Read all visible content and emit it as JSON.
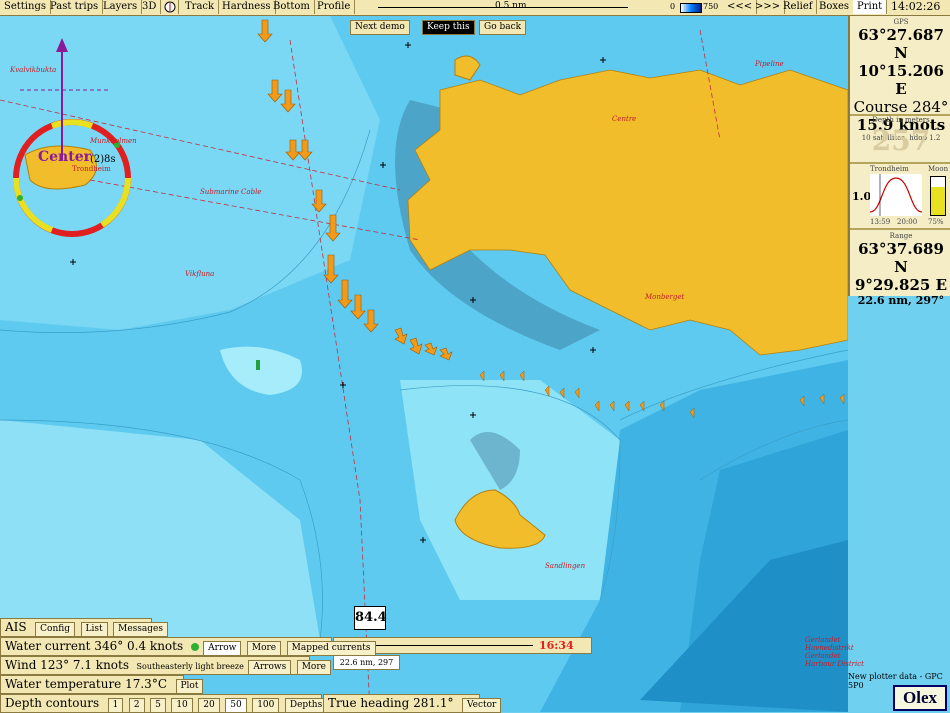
{
  "menu": {
    "items": [
      "Settings",
      "Past trips",
      "Layers",
      "3D",
      "Track",
      "Hardness",
      "Bottom",
      "Profile"
    ],
    "right_items": [
      "<<<",
      ">>>",
      "Relief",
      "Boxes",
      "Print"
    ],
    "scale_label": "0.5 nm",
    "depth_min": "0",
    "depth_max": "750",
    "clock": "14:02:26"
  },
  "demo": {
    "next": "Next demo",
    "keep": "Keep this",
    "back": "Go back"
  },
  "gps": {
    "source": "GPS",
    "lat": "63°27.687 N",
    "lon": "10°15.206 E",
    "course": "Course 284°",
    "speed": "15.9 knots",
    "sats": "10 satellites, hdop 1.2"
  },
  "depth": {
    "label": "Depth in meters",
    "value": "257"
  },
  "tide": {
    "label": "Trondheim",
    "value": "1.0",
    "t1": "13:59",
    "t2": "20:00",
    "moon_label": "Moon",
    "moon_pct": "75%",
    "moon_fill": 0.75
  },
  "range": {
    "label": "Range",
    "lat": "63°37.689 N",
    "lon": "9°29.825 E",
    "dist": "22.6 nm, 297°"
  },
  "compass": {
    "center_label": "Center",
    "place": "Trondheim",
    "badge": "(2)",
    "eta": "8s"
  },
  "track_info": {
    "value": "84.4",
    "dist": "22.6 nm, 297",
    "time": "16:34"
  },
  "bottom": {
    "ais": {
      "label": "AIS",
      "buttons": [
        "Config",
        "List",
        "Messages"
      ]
    },
    "current": {
      "text": "Water current 346° 0.4 knots",
      "buttons": [
        "Arrow",
        "More",
        "Mapped currents"
      ]
    },
    "wind": {
      "text": "Wind 123° 7.1 knots",
      "desc": "Southeasterly light breeze",
      "buttons": [
        "Arrows",
        "More"
      ]
    },
    "temp": {
      "text": "Water temperature 17.3°C",
      "buttons": [
        "Plot"
      ]
    },
    "contours": {
      "label": "Depth contours",
      "values": [
        "1",
        "2",
        "5",
        "10",
        "20",
        "50",
        "100"
      ],
      "depths_btn": "Depths"
    },
    "heading": {
      "text": "True heading 281.1°",
      "buttons": [
        "Vector"
      ]
    }
  },
  "footer": {
    "notice": "New plotter data - GPC 5P0",
    "brand": "Olex"
  },
  "chart_labels": {
    "fjord_north": "Kvalvikbukta",
    "cable": "Submarine Cable",
    "munkholmen": "Munkholmen",
    "main_land": "Centre",
    "mountain": "Monberget",
    "south_island": "Sandlingen",
    "pipeline": "Pipeline",
    "district": "Gerlandet Havnedistrikt Gerlandet Harbour District",
    "rocks": "Vikfluna"
  },
  "colors": {
    "land": "#f2bd2a",
    "deep": "#38b8e8",
    "shallow": "#96e4f8",
    "arrow": "#f29a1a"
  }
}
